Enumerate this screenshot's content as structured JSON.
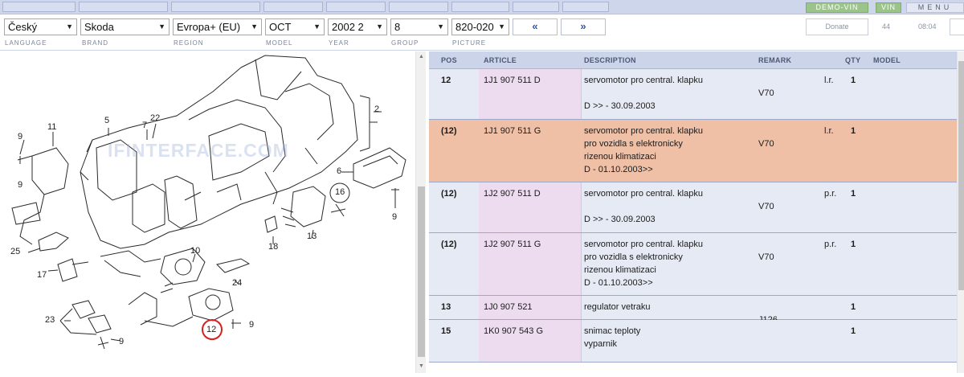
{
  "topbar": {
    "demo_vin": "DEMO-VIN",
    "vin": "VIN",
    "menu": "MENU"
  },
  "selectors": [
    {
      "value": "Český",
      "caption": "LANGUAGE"
    },
    {
      "value": "Skoda",
      "caption": "BRAND"
    },
    {
      "value": "Evropa+ (EU)",
      "caption": "REGION"
    },
    {
      "value": "OCT",
      "caption": "MODEL"
    },
    {
      "value": "2002  2",
      "caption": "YEAR"
    },
    {
      "value": "8",
      "caption": "GROUP"
    },
    {
      "value": "820-020",
      "caption": "PICTURE"
    }
  ],
  "nav": {
    "prev": "«",
    "next": "»"
  },
  "donate": "Donate",
  "counter": "44",
  "time": "08:04",
  "watermark": "IFINTERFACE.COM",
  "callouts": [
    "2",
    "5",
    "7",
    "22",
    "11",
    "9",
    "6",
    "16",
    "9",
    "13",
    "18",
    "10",
    "25",
    "17",
    "24",
    "23",
    "12",
    "9",
    "9",
    "9"
  ],
  "table": {
    "columns": {
      "pos": "POS",
      "article": "ARTICLE",
      "description": "DESCRIPTION",
      "remark": "REMARK",
      "qty": "QTY",
      "model": "MODEL"
    },
    "rows": [
      {
        "pos": "12",
        "article": "1J1 907 511 D",
        "description": [
          "servomotor pro central. klapku",
          "",
          "D          >> - 30.09.2003"
        ],
        "side": "l.r.",
        "remark": "V70",
        "qty": "1",
        "highlight": false
      },
      {
        "pos": "(12)",
        "article": "1J1 907 511 G",
        "description": [
          "servomotor pro central. klapku",
          "pro vozidla s elektronicky",
          "rizenou klimatizaci",
          "D - 01.10.2003>>"
        ],
        "side": "l.r.",
        "remark": "V70",
        "qty": "1",
        "highlight": true
      },
      {
        "pos": "(12)",
        "article": "1J2 907 511 D",
        "description": [
          "servomotor pro central. klapku",
          "",
          "D          >> - 30.09.2003"
        ],
        "side": "p.r.",
        "remark": "V70",
        "qty": "1",
        "highlight": false
      },
      {
        "pos": "(12)",
        "article": "1J2 907 511 G",
        "description": [
          "servomotor pro central. klapku",
          "pro vozidla s elektronicky",
          "rizenou klimatizaci",
          "D - 01.10.2003>>"
        ],
        "side": "p.r.",
        "remark": "V70",
        "qty": "1",
        "highlight": false
      },
      {
        "pos": "13",
        "article": "1J0 907 521",
        "description": [
          "regulator vetraku"
        ],
        "side": "",
        "remark": "J126",
        "qty": "1",
        "highlight": false
      },
      {
        "pos": "15",
        "article": "1K0 907 543 G",
        "description": [
          "snimac teploty",
          "vyparnik"
        ],
        "side": "",
        "remark": "",
        "qty": "1",
        "highlight": false
      }
    ]
  },
  "colors": {
    "highlight_row": "#efc0a6",
    "article_column": "#eddcef",
    "header": "#ccd4ea",
    "selected_callout": "#d62020"
  }
}
